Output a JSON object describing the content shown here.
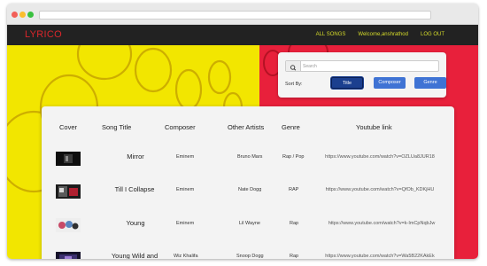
{
  "nav": {
    "brand": "LYRICO",
    "links": [
      "ALL SONGS",
      "Welcome,anshrathod",
      "LOG OUT"
    ]
  },
  "search": {
    "placeholder": "Search",
    "sort_label": "Sort By:",
    "sort_options": [
      "Title",
      "Composer",
      "Genre"
    ],
    "active_sort": "Title"
  },
  "table": {
    "headers": [
      "Cover",
      "Song Title",
      "Composer",
      "Other Artists",
      "Genre",
      "Youtube link"
    ],
    "rows": [
      {
        "title": "Mirror",
        "composer": "Eminem",
        "artists": "Bruno Mars",
        "genre": "Rap / Pop",
        "link": "https://www.youtube.com/watch?v=OZLUa8JUR18"
      },
      {
        "title": "Till I Collapse",
        "composer": "Eminem",
        "artists": "Nate Dogg",
        "genre": "RAP",
        "link": "https://www.youtube.com/watch?v=QfOb_KDKjHU"
      },
      {
        "title": "Young",
        "composer": "Eminem",
        "artists": "Lil Wayne",
        "genre": "Rap",
        "link": "https://www.youtube.com/watch?v=k-ImCpNqbJw"
      },
      {
        "title": "Young Wild and",
        "composer": "Wiz Khalifa",
        "artists": "Snoop Dogg",
        "genre": "Rap",
        "link": "https://www.youtube.com/watch?v=Wa5B22KAkEk"
      }
    ]
  },
  "colors": {
    "navbar": "#222222",
    "brand": "#d9262b",
    "nav_link": "#d6dc2a",
    "hero_yellow": "#f2e600",
    "hero_red": "#e8203b",
    "sort_active": "#1b3f8f",
    "sort_button": "#3f73d4"
  }
}
